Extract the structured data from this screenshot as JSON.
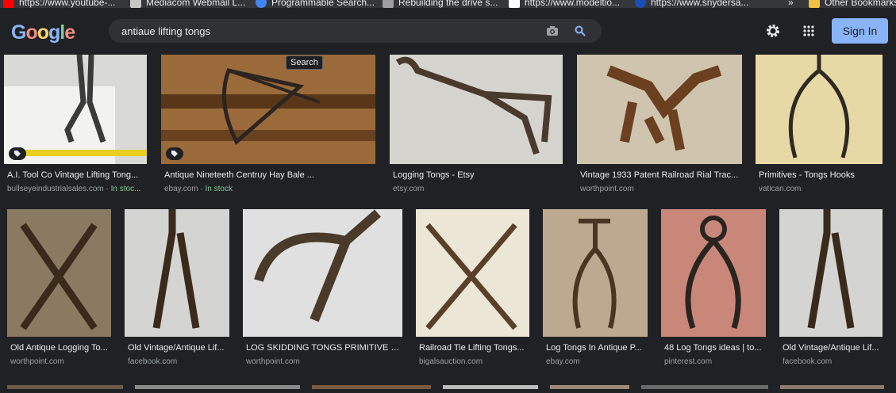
{
  "bookmarks": [
    {
      "label": "https://www.youtube-...",
      "color": "#ff0000"
    },
    {
      "label": "Mediacom Webmail L...",
      "color": "#c8c8c8"
    },
    {
      "label": "Programmable Search...",
      "color": "#4285f4"
    },
    {
      "label": "Rebuilding the drive s...",
      "color": "#a0a0a0"
    },
    {
      "label": "https://www.modeltio...",
      "color": "#ffffff"
    },
    {
      "label": "https://www.snydersa...",
      "color": "#1a4db3"
    },
    {
      "label": "»",
      "color": ""
    },
    {
      "label": "Other Bookmarks",
      "color": "#f0c040"
    }
  ],
  "header": {
    "logo": "Google",
    "query": "antiaue lifting tongs",
    "sign_in": "Sign In",
    "tooltip": "Search"
  },
  "results": [
    {
      "title": "A.I. Tool Co Vintage Lifting Tong...",
      "source": "bullseyeindustrialsales.com",
      "stock": " · In stoc...",
      "bg": "#b8b8b4"
    },
    {
      "title": "Antique Nineteeth Centruy Hay Bale ...",
      "source": "ebay.com",
      "stock": " · In stock",
      "bg": "#8a5a30"
    },
    {
      "title": "Logging Tongs - Etsy",
      "source": "etsy.com",
      "stock": "",
      "bg": "#d6d4cf"
    },
    {
      "title": "Vintage 1933 Patent Railroad Rial Trac...",
      "source": "worthpoint.com",
      "stock": "",
      "bg": "#c8bda8"
    },
    {
      "title": "Primitives - Tongs Hooks",
      "source": "vatican.com",
      "stock": "",
      "bg": "#e3d6a2"
    },
    {
      "title": "Old Antique Logging To...",
      "source": "worthpoint.com",
      "stock": "",
      "bg": "#7a6a55"
    },
    {
      "title": "Old Vintage/Antique Lif...",
      "source": "facebook.com",
      "stock": "",
      "bg": "#c9c9c7"
    },
    {
      "title": "LOG SKIDDING TONGS PRIMITIVE M...",
      "source": "worthpoint.com",
      "stock": "",
      "bg": "#dcdcdc"
    },
    {
      "title": "Railroad Tie Lifting Tongs...",
      "source": "bigalsauction.com",
      "stock": "",
      "bg": "#e8e2d2"
    },
    {
      "title": "Log Tongs In Antique P...",
      "source": "ebay.com",
      "stock": "",
      "bg": "#b7a58e"
    },
    {
      "title": "48 Log Tongs ideas | to...",
      "source": "pinterest.com",
      "stock": "",
      "bg": "#d07870"
    },
    {
      "title": "Old Vintage/Antique Lif...",
      "source": "facebook.com",
      "stock": "",
      "bg": "#c9c9c7"
    }
  ],
  "icons": {
    "camera": "camera-icon",
    "search": "search-icon",
    "settings": "gear-icon",
    "apps": "apps-grid-icon",
    "tag": "shopping-tag-icon"
  }
}
